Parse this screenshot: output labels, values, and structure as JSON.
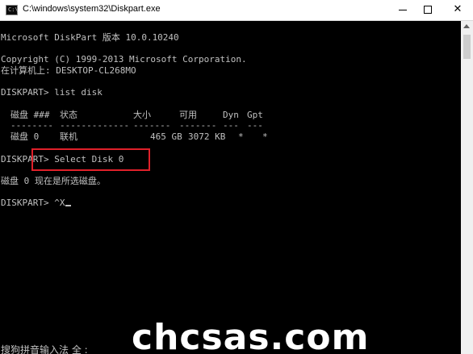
{
  "window": {
    "title": "C:\\windows\\system32\\Diskpart.exe",
    "icon": "console-icon",
    "controls": {
      "minimize": "minimize-icon",
      "maximize": "maximize-icon",
      "close_glyph": "✕"
    }
  },
  "console": {
    "version_line": "Microsoft DiskPart 版本 10.0.10240",
    "copyright_line": "Copyright (C) 1999-2013 Microsoft Corporation.",
    "computer_line": "在计算机上: DESKTOP-CL268MO",
    "cmd1": "DISKPART> list disk",
    "table": {
      "headers": [
        "磁盘 ###",
        "状态",
        "大小",
        "可用",
        "Dyn",
        "Gpt"
      ],
      "separators": [
        "--------",
        "-------------",
        "-------",
        "-------",
        "---",
        "---"
      ],
      "rows": [
        [
          "磁盘 0",
          "联机",
          "465 GB",
          "3072 KB",
          "*",
          "*"
        ]
      ]
    },
    "cmd2": "DISKPART> Select Disk 0",
    "result2": "磁盘 0 现在是所选磁盘。",
    "cmd3": "DISKPART> ^X"
  },
  "ime": {
    "status": "搜狗拼音输入法 全 :"
  },
  "watermark": {
    "text": "chcsas.com"
  },
  "colors": {
    "console_bg": "#000000",
    "console_fg": "#c0c0c0",
    "highlight": "#e0202a"
  }
}
